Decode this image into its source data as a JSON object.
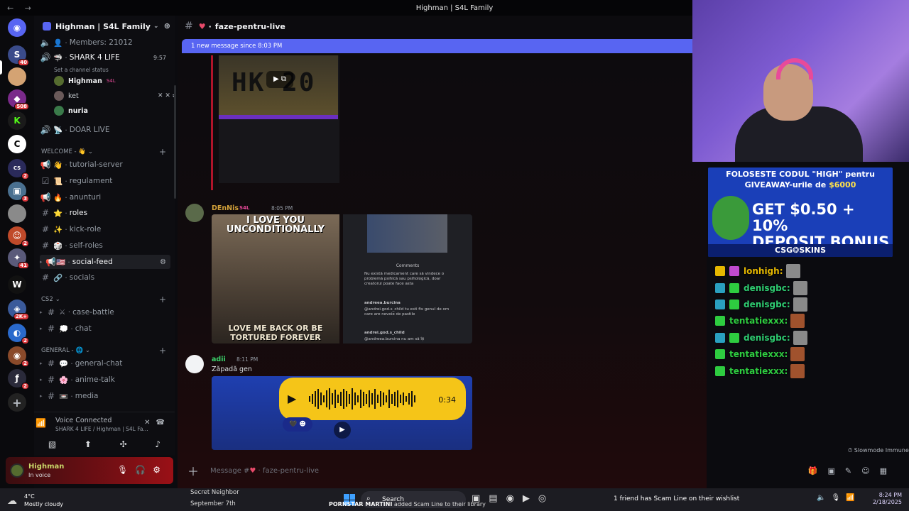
{
  "window": {
    "title": "Highman | S4L Family",
    "nav": "← →"
  },
  "servers": [
    {
      "name": "discord-home",
      "badge": ""
    },
    {
      "name": "server-1",
      "badge": "40"
    },
    {
      "name": "server-2",
      "badge": ""
    },
    {
      "name": "server-3",
      "badge": "508"
    },
    {
      "name": "server-4",
      "badge": ""
    },
    {
      "name": "server-5",
      "badge": ""
    },
    {
      "name": "server-6",
      "badge": "2"
    },
    {
      "name": "server-7",
      "badge": "3"
    },
    {
      "name": "server-8",
      "badge": ""
    },
    {
      "name": "server-9",
      "badge": "2"
    },
    {
      "name": "server-10",
      "badge": "41"
    },
    {
      "name": "server-11",
      "badge": ""
    },
    {
      "name": "server-12",
      "badge": "2K+"
    },
    {
      "name": "server-13",
      "badge": "2"
    },
    {
      "name": "server-14",
      "badge": "2"
    },
    {
      "name": "server-15",
      "badge": "2"
    }
  ],
  "sidebar": {
    "guild_name": "Highman | S4L Family",
    "members": "Members: 21012",
    "voice_channel": "SHARK 4 LIFE",
    "voice_time": "9:57",
    "set_status": "Set a channel status",
    "voice_users": [
      {
        "name": "Highman",
        "tag": "S4L"
      },
      {
        "name": "ket",
        "tag": ""
      },
      {
        "name": "nuria",
        "tag": ""
      }
    ],
    "doar_live": "DOAR LIVE",
    "cat_welcome": "WELCOME - 👋",
    "welcome_channels": [
      "tutorial-server",
      "regulament",
      "anunturi",
      "roles",
      "kick-role",
      "self-roles",
      "social-feed",
      "socials"
    ],
    "cat_cs2": "CS2",
    "cs2_channels": [
      "case-battle",
      "chat"
    ],
    "cat_general": "GENERAL -",
    "general_channels": [
      "general-chat",
      "anime-talk",
      "media"
    ]
  },
  "voice_panel": {
    "status": "Voice Connected",
    "location": "SHARK 4 LIFE / Highman | S4L Fa..."
  },
  "user_panel": {
    "name": "Highman",
    "status": "In voice"
  },
  "chat": {
    "channel": "faze-pentru-live",
    "new_message_bar": "1 new message since 8:03 PM",
    "plate_text": "HK 20",
    "msg1": {
      "author": "DEnNis",
      "tag": "S4L",
      "time": "8:05 PM"
    },
    "meme_top": "I LOVE YOU UNCONDITIONALLY",
    "meme_bottom": "LOVE ME BACK OR BE TORTURED FOREVER",
    "comments_title": "Comments",
    "comment1": "Nu există medicament care să vindece o problemă psihică sau psihologică, doar creatorul poate face asta",
    "comment2_user": "andreea.burcina",
    "comment2": "@andrei.god.s_child tu esti fix genul de om care are nevoie de pastile",
    "comment3_user": "andrei.god.s_child",
    "comment3": "@andreea.burcina nu am să îți",
    "msg2": {
      "author": "adii",
      "time": "8:11 PM",
      "text": "Zăpadă gen"
    },
    "audio_duration": "0:34",
    "composer_placeholder": "Message #",
    "composer_channel": "faze-pentru-live",
    "slowmode": "Slowmode Immune"
  },
  "stream": {
    "ad_line1": "FOLOSESTE CODUL \"HIGH\" pentru",
    "ad_line2_prefix": "GIVEAWAY-urile de ",
    "ad_line2_amount": "$6000",
    "ad_big1": "GET $0.50 + 10%",
    "ad_big2": "DEPOSIT BONUS",
    "ad_brand": "CSG❂SKINS",
    "chat": [
      {
        "user": "lonhigh:",
        "color": "#e6b800"
      },
      {
        "user": "denisgbc:",
        "color": "#2ecc71"
      },
      {
        "user": "denisgbc:",
        "color": "#2ecc71"
      },
      {
        "user": "tentatiexxx:",
        "color": "#2ecc40"
      },
      {
        "user": "denisgbc:",
        "color": "#2ecc71"
      },
      {
        "user": "tentatiexxx:",
        "color": "#2ecc40"
      },
      {
        "user": "tentatiexxx:",
        "color": "#2ecc40"
      }
    ]
  },
  "taskbar": {
    "temp": "4°C",
    "weather": "Mostly cloudy",
    "notif1": "Secret Neighbor",
    "notif2": "September 7th",
    "search": "Search",
    "game_user": "PORNSTAR MARTINI",
    "game_text": "added",
    "game_title": "Scam Line to their library",
    "ticker": "1 friend has Scam Line on their wishlist",
    "time": "8:24 PM",
    "date": "2/18/2025"
  },
  "colors": {
    "accent": "#5865f2",
    "user_panel": "#9a1016",
    "ad_bg": "#1a3fb8"
  }
}
